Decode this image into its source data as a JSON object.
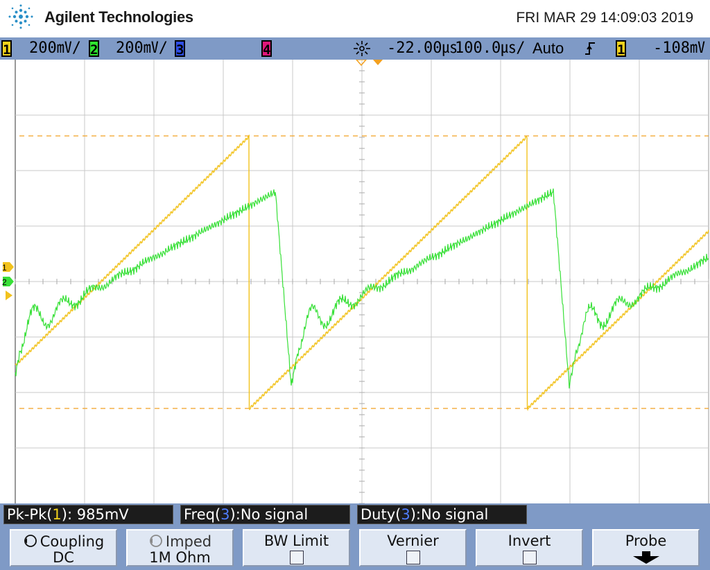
{
  "header": {
    "brand": "Agilent Technologies",
    "datetime": "FRI MAR 29 14:09:03 2019",
    "logo_icon": "agilent-spark-logo"
  },
  "status_bar": {
    "ch1": {
      "number": "1",
      "scale": "200㎷/",
      "color": "#f2d21c"
    },
    "ch2": {
      "number": "2",
      "scale": "200㎷/",
      "color": "#2fe52f"
    },
    "ch3": {
      "number": "3",
      "color": "#2f4fe6"
    },
    "ch4": {
      "number": "4",
      "color": "#e0167a"
    },
    "timebase_icon": "time-reference-icon",
    "delay": "-22.00㎲",
    "time_per_div": "100.0㎲/",
    "trigger_mode": "Auto",
    "trigger_slope_icon": "rising-edge-icon",
    "trigger_source": "1",
    "trigger_level": "-108㎷"
  },
  "display": {
    "background": "#ffffff",
    "grid_color": "#c8c8c8",
    "cursor_color": "#f2a020",
    "channel1_marker": "1",
    "channel2_marker": "2",
    "waveform_period_divisions": 4,
    "ch1_waveform": "sawtooth",
    "ch2_waveform": "sawtooth with ringing"
  },
  "measurements": [
    {
      "prefix": "Pk-Pk(",
      "channel": "1",
      "suffix": "): 985mV"
    },
    {
      "prefix": "Freq(",
      "channel": "3",
      "suffix": "):No signal"
    },
    {
      "prefix": "Duty(",
      "channel": "3",
      "suffix": "):No signal"
    }
  ],
  "softkeys": {
    "coupling": {
      "label": "Coupling",
      "value": "DC",
      "icon": "cycle-arrow-icon"
    },
    "imped": {
      "label": "Imped",
      "value": "1M Ohm",
      "icon": "cycle-arrow-icon"
    },
    "bw_limit": {
      "label": "BW Limit",
      "checked": false
    },
    "vernier": {
      "label": "Vernier",
      "checked": false
    },
    "invert": {
      "label": "Invert",
      "checked": false
    },
    "probe": {
      "label": "Probe",
      "icon": "down-arrow-icon"
    }
  }
}
